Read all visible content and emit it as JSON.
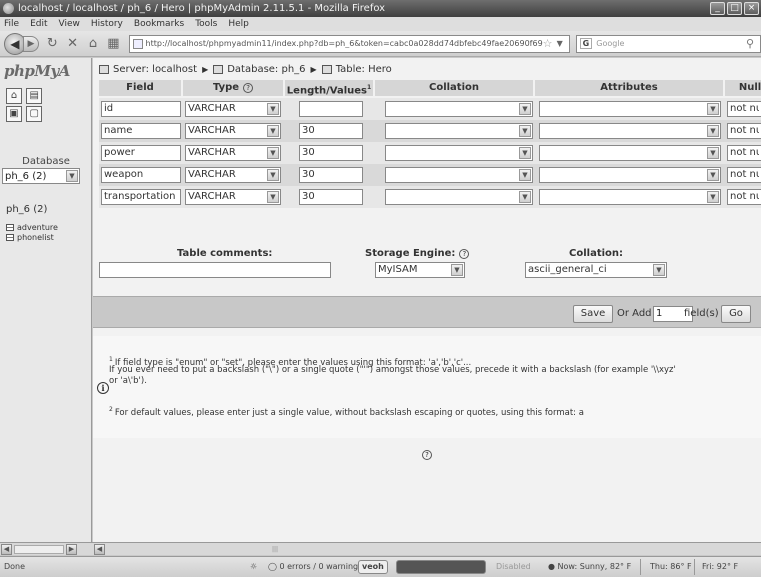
{
  "window": {
    "title": "localhost / localhost / ph_6 / Hero | phpMyAdmin 2.11.5.1 - Mozilla Firefox",
    "controls": [
      "_",
      "□",
      "×"
    ]
  },
  "menu": [
    "File",
    "Edit",
    "View",
    "History",
    "Bookmarks",
    "Tools",
    "Help"
  ],
  "nav": {
    "url": "http://localhost/phpmyadmin11/index.php?db=ph_6&token=cabc0a028dd74dbfebc49fae20690f69",
    "search_engine": "G",
    "search_placeholder": "Google"
  },
  "left": {
    "logo": "phpMyA",
    "db_label": "Database",
    "db_selected": "ph_6 (2)",
    "db_name": "ph_6 (2)",
    "tables": [
      "adventure",
      "phonelist"
    ]
  },
  "breadcrumb": {
    "server": "Server: localhost",
    "database": "Database: ph_6",
    "table": "Table: Hero"
  },
  "columns": {
    "field": "Field",
    "type": "Type",
    "length": "Length/Values",
    "length_sup": "1",
    "collation": "Collation",
    "attributes": "Attributes",
    "null": "Null"
  },
  "rows": [
    {
      "field": "id",
      "type": "VARCHAR",
      "length": "",
      "null": "not null"
    },
    {
      "field": "name",
      "type": "VARCHAR",
      "length": "30",
      "null": "not null"
    },
    {
      "field": "power",
      "type": "VARCHAR",
      "length": "30",
      "null": "not null"
    },
    {
      "field": "weapon",
      "type": "VARCHAR",
      "length": "30",
      "null": "not null"
    },
    {
      "field": "transportation",
      "type": "VARCHAR",
      "length": "30",
      "null": "not null"
    }
  ],
  "table_options": {
    "comments_label": "Table comments:",
    "engine_label": "Storage Engine:",
    "engine_value": "MyISAM",
    "collation_label": "Collation:",
    "collation_value": "ascii_general_ci"
  },
  "actions": {
    "save": "Save",
    "or_add": "Or Add",
    "add_count": "1",
    "fields_label": "field(s)",
    "go": "Go"
  },
  "notes": {
    "note1_num": "1",
    "note1_line1": "If field type is \"enum\" or \"set\", please enter the values using this format: 'a','b','c'...",
    "note1_line2": "If you ever need to put a backslash (\"\\\") or a single quote (\"'\") amongst those values, precede it with a backslash (for example '\\\\xyz'",
    "note1_line3": "or 'a\\'b').",
    "note2_num": "2",
    "note2": "For default values, please enter just a single value, without backslash escaping or quotes, using this format: a"
  },
  "status": {
    "done": "Done",
    "errors": "0 errors / 0 warnings",
    "veoh": "veoh",
    "disabled": "Disabled",
    "weather_now": "Now: Sunny, 82° F",
    "weather_thu": "Thu: 86° F",
    "weather_fri": "Fri: 92° F"
  }
}
